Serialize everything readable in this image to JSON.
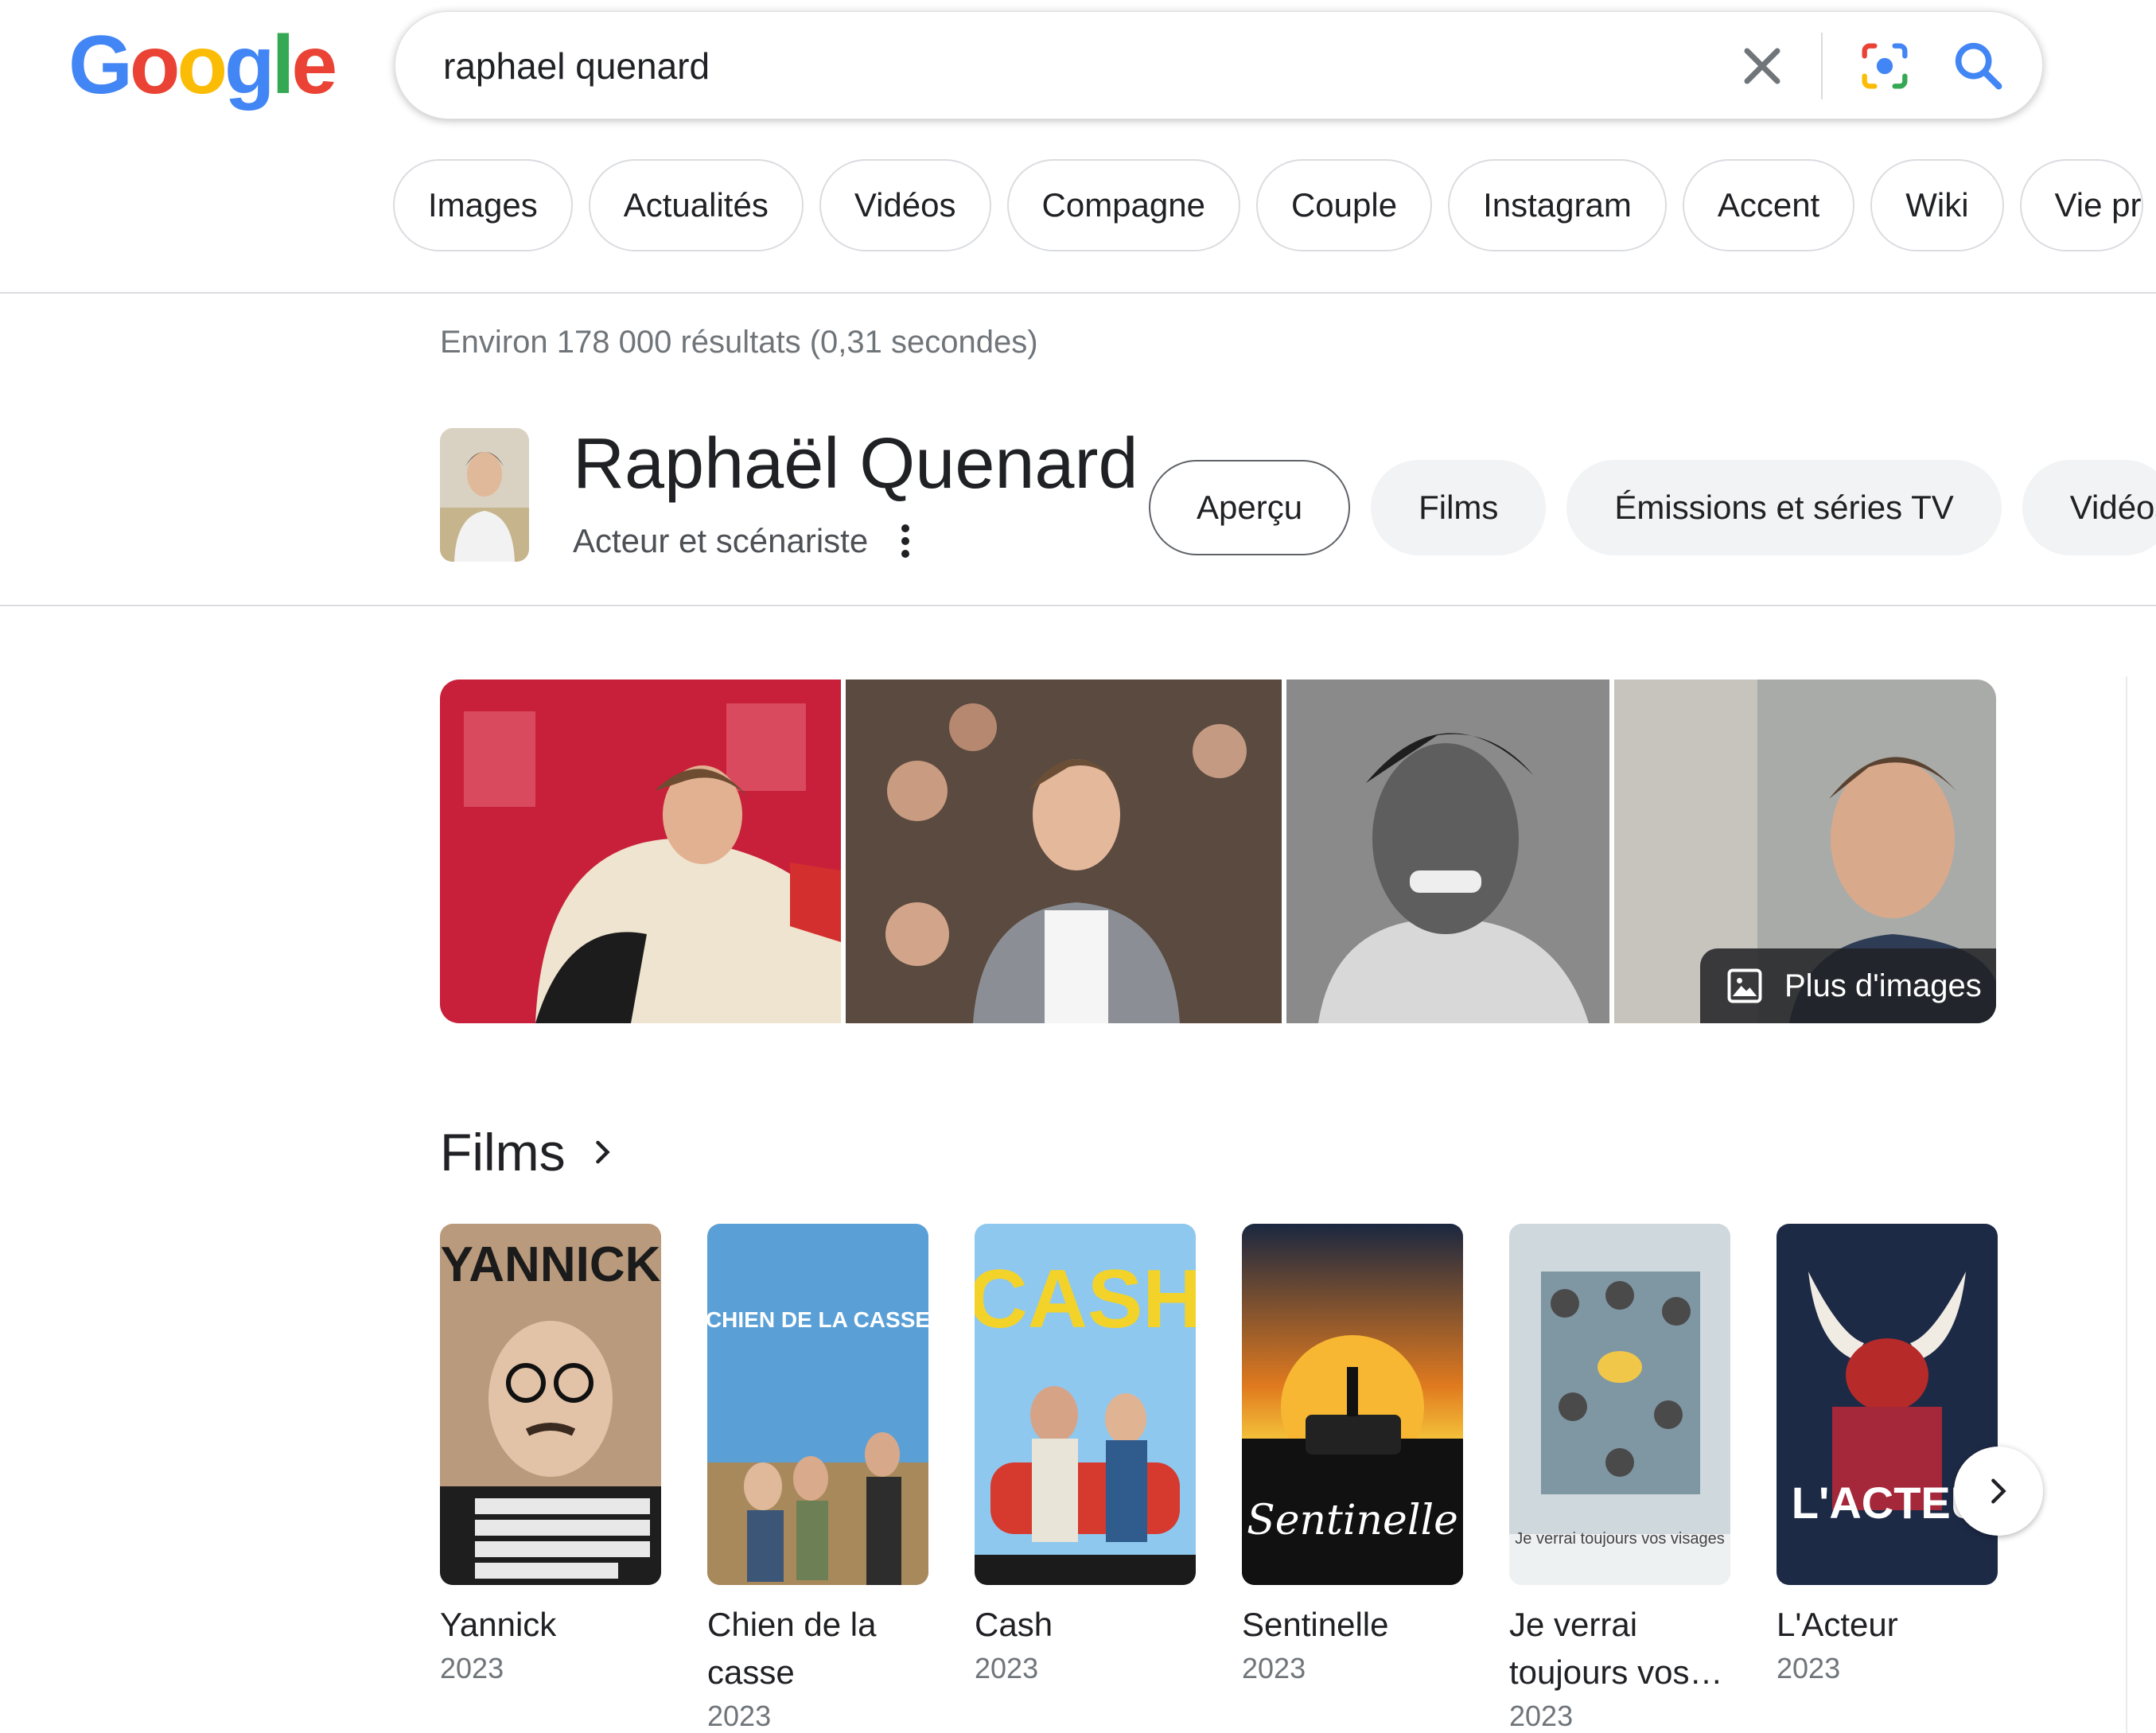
{
  "logo": {
    "letters": [
      "G",
      "o",
      "o",
      "g",
      "l",
      "e"
    ],
    "colors": [
      "#4285F4",
      "#EA4335",
      "#FBBC05",
      "#4285F4",
      "#34A853",
      "#EA4335"
    ]
  },
  "search": {
    "query": "raphael quenard",
    "clear_icon": "close-icon",
    "lens_icon": "camera-lens-icon",
    "search_icon": "search-icon"
  },
  "chips": [
    "Images",
    "Actualités",
    "Vidéos",
    "Compagne",
    "Couple",
    "Instagram",
    "Accent",
    "Wiki",
    "Vie pr"
  ],
  "stats": "Environ 178 000 résultats (0,31 secondes)",
  "entity": {
    "title": "Raphaël Quenard",
    "subtitle": "Acteur et scénariste",
    "tabs": [
      "Aperçu",
      "Films",
      "Émissions et séries TV",
      "Vidéos"
    ]
  },
  "images": {
    "more_label": "Plus d'images"
  },
  "films": {
    "heading": "Films",
    "items": [
      {
        "title": "Yannick",
        "year": "2023",
        "poster_text": "YANNICK"
      },
      {
        "title": "Chien de la casse",
        "year": "2023",
        "poster_text": "CHIEN DE LA CASSE"
      },
      {
        "title": "Cash",
        "year": "2023",
        "poster_text": "CASH"
      },
      {
        "title": "Sentinelle",
        "year": "2023",
        "poster_text": "Sentinelle"
      },
      {
        "title": "Je verrai toujours vos…",
        "year": "2023",
        "poster_text": "Je verrai toujours vos visages"
      },
      {
        "title": "L'Acteur",
        "year": "2023",
        "poster_text": "L'ACTEU"
      }
    ]
  },
  "colors": {
    "accent_blue": "#4285F4",
    "link_blue": "#1a73e8",
    "muted": "#70757a"
  }
}
